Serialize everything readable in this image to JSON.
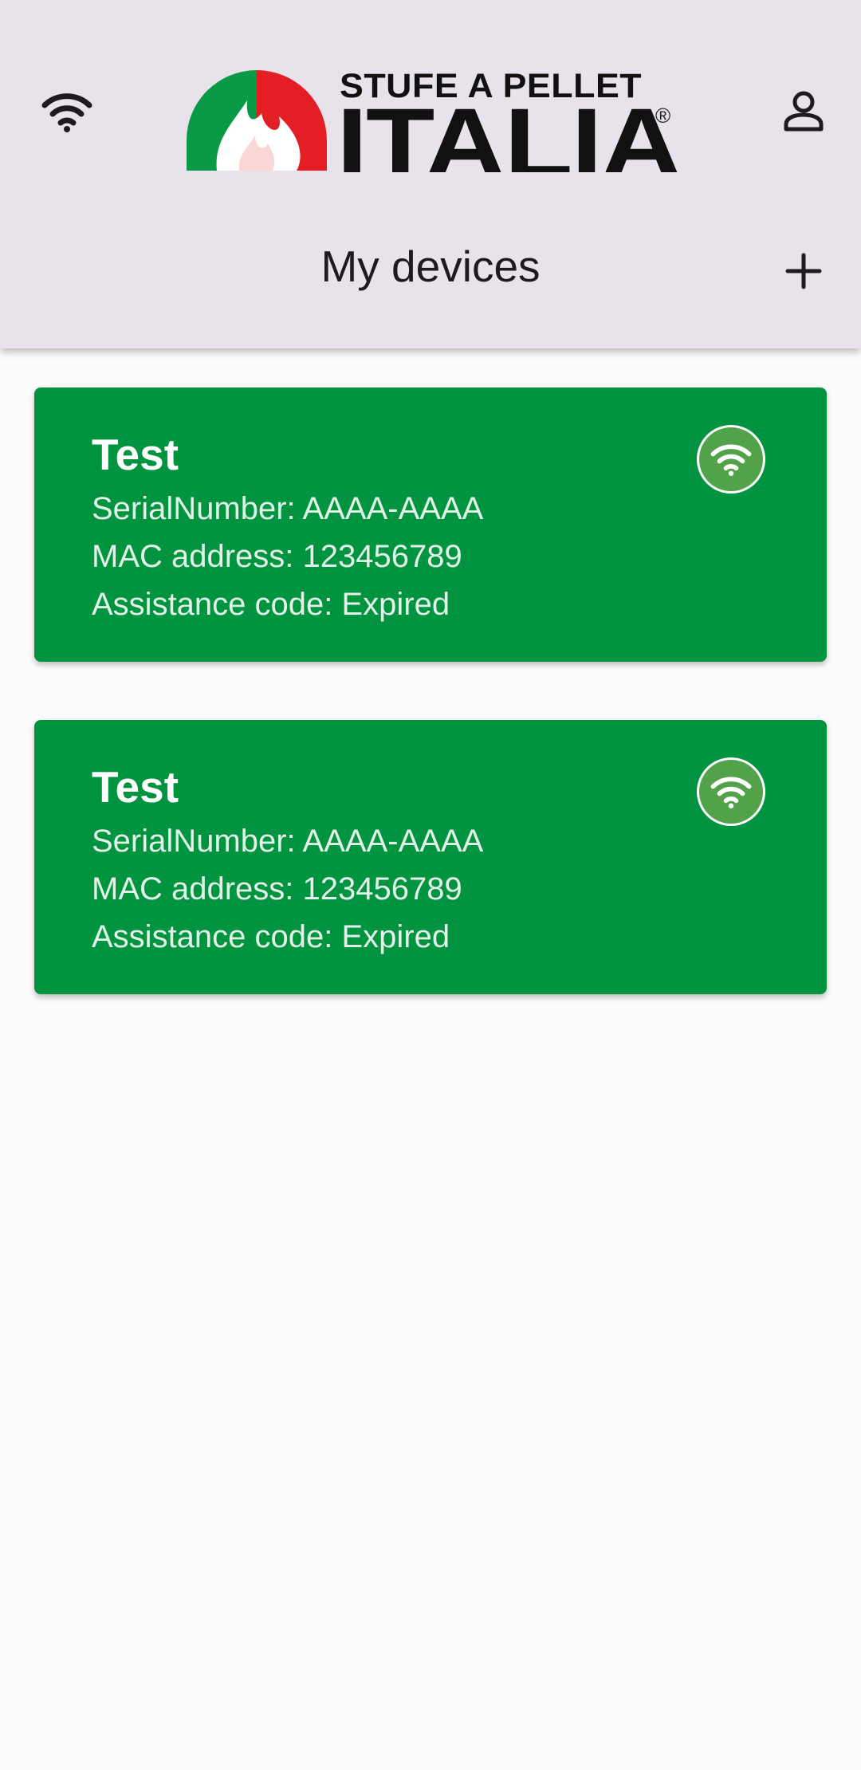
{
  "header": {
    "logo": {
      "text_top": "STUFE A PELLET",
      "text_main": "ITALIA",
      "registered": "®",
      "colors": {
        "green": "#0a9a47",
        "red": "#e31e24",
        "white": "#ffffff"
      }
    },
    "title": "My devices",
    "left_icon": "wifi-icon",
    "right_icon": "user-icon",
    "action_icon": "plus-icon"
  },
  "devices": [
    {
      "name": "Test",
      "serial": "SerialNumber: AAAA-AAAA",
      "mac": "MAC address: 123456789",
      "assistance": "Assistance code: Expired",
      "status_icon": "wifi-connected-icon"
    },
    {
      "name": "Test",
      "serial": "SerialNumber: AAAA-AAAA",
      "mac": "MAC address: 123456789",
      "assistance": "Assistance code: Expired",
      "status_icon": "wifi-connected-icon"
    }
  ],
  "colors": {
    "header_bg": "#e8e3ea",
    "card_bg": "#019440",
    "status_circle": "#52a24a",
    "page_bg": "#fdfcfd"
  }
}
